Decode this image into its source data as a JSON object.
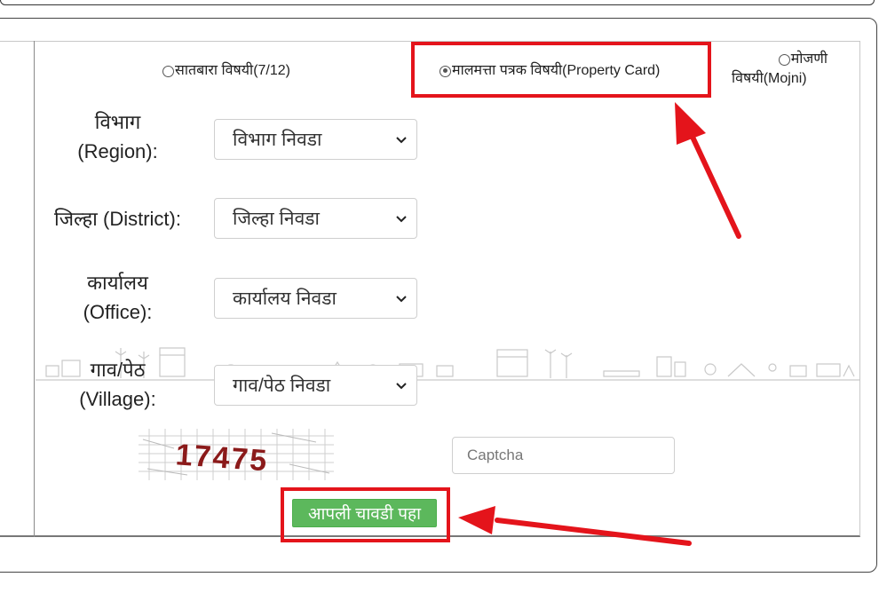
{
  "radios": [
    {
      "label": "सातबारा विषयी(7/12)",
      "checked": false
    },
    {
      "label": "मालमत्ता पत्रक विषयी(Property Card)",
      "checked": true
    },
    {
      "label_line1": "मोजणी",
      "label_line2": "विषयी(Mojni)",
      "checked": false
    }
  ],
  "fields": {
    "region": {
      "label_line1": "विभाग",
      "label_line2": "(Region):",
      "selected": "विभाग निवडा"
    },
    "district": {
      "label": "जिल्हा (District):",
      "selected": "जिल्हा निवडा"
    },
    "office": {
      "label_line1": "कार्यालय",
      "label_line2": "(Office):",
      "selected": "कार्यालय निवडा"
    },
    "village": {
      "label_line1": "गाव/पेठ",
      "label_line2": "(Village):",
      "selected": "गाव/पेठ निवडा"
    }
  },
  "captcha": {
    "image_text": "17475",
    "placeholder": "Captcha"
  },
  "submit_label": "आपली चावडी पहा",
  "colors": {
    "highlight": "#e4141b",
    "button": "#5cb85c",
    "captcha_text": "#8b1a1a"
  }
}
